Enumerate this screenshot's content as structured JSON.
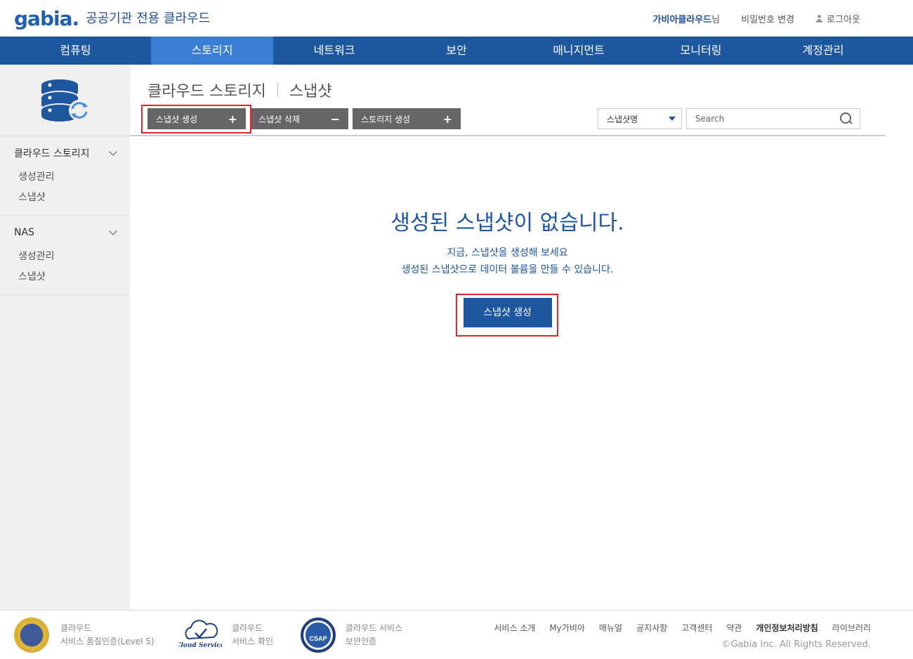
{
  "header": {
    "logo": "gabia.",
    "subtitle": "공공기관 전용 클라우드",
    "user_name": "가비아클라우드",
    "user_suffix": "님",
    "change_password": "비밀번호 변경",
    "logout": "로그아웃"
  },
  "nav": {
    "items": [
      "컴퓨팅",
      "스토리지",
      "네트워크",
      "보안",
      "매니지먼트",
      "모니터링",
      "계정관리"
    ],
    "active": "스토리지"
  },
  "sidebar": {
    "groups": [
      {
        "title": "클라우드 스토리지",
        "items": [
          "생성관리",
          "스냅샷"
        ]
      },
      {
        "title": "NAS",
        "items": [
          "생성관리",
          "스냅샷"
        ]
      }
    ]
  },
  "page": {
    "breadcrumb_parent": "클라우드 스토리지",
    "breadcrumb_current": "스냅샷"
  },
  "toolbar": {
    "create_snapshot": "스냅샷 생성",
    "delete_snapshot": "스냅샷 삭제",
    "create_storage": "스토리지 생성",
    "plus": "+",
    "minus": "−"
  },
  "search": {
    "filter_selected": "스냅샷명",
    "placeholder": "Search"
  },
  "empty_state": {
    "title": "생성된 스냅샷이 없습니다.",
    "line1": "지금, 스냅샷을 생성해 보세요",
    "line2": "생성된 스냅샷으로 데이터 볼륨을 만들 수 있습니다.",
    "button": "스냅샷 생성"
  },
  "footer": {
    "cert1_line1": "클라우드",
    "cert1_line2": "서비스 품질인증(Level 5)",
    "cert2_line1": "클라우드",
    "cert2_line2": "서비스 확인",
    "cert2_logo_text": "Cloud Service",
    "cert3_line1": "클라우드 서비스",
    "cert3_line2": "보안인증",
    "cert3_logo_text": "CSAP",
    "links": [
      "서비스 소개",
      "My가비아",
      "매뉴얼",
      "공지사항",
      "고객센터",
      "약관",
      "개인정보처리방침",
      "라이브러리"
    ],
    "copyright": "©Gabia Inc. All Rights Reserved."
  },
  "colors": {
    "nav_bg": "#1e56a0",
    "nav_active": "#3b7fd4",
    "highlight": "#e0262c"
  }
}
